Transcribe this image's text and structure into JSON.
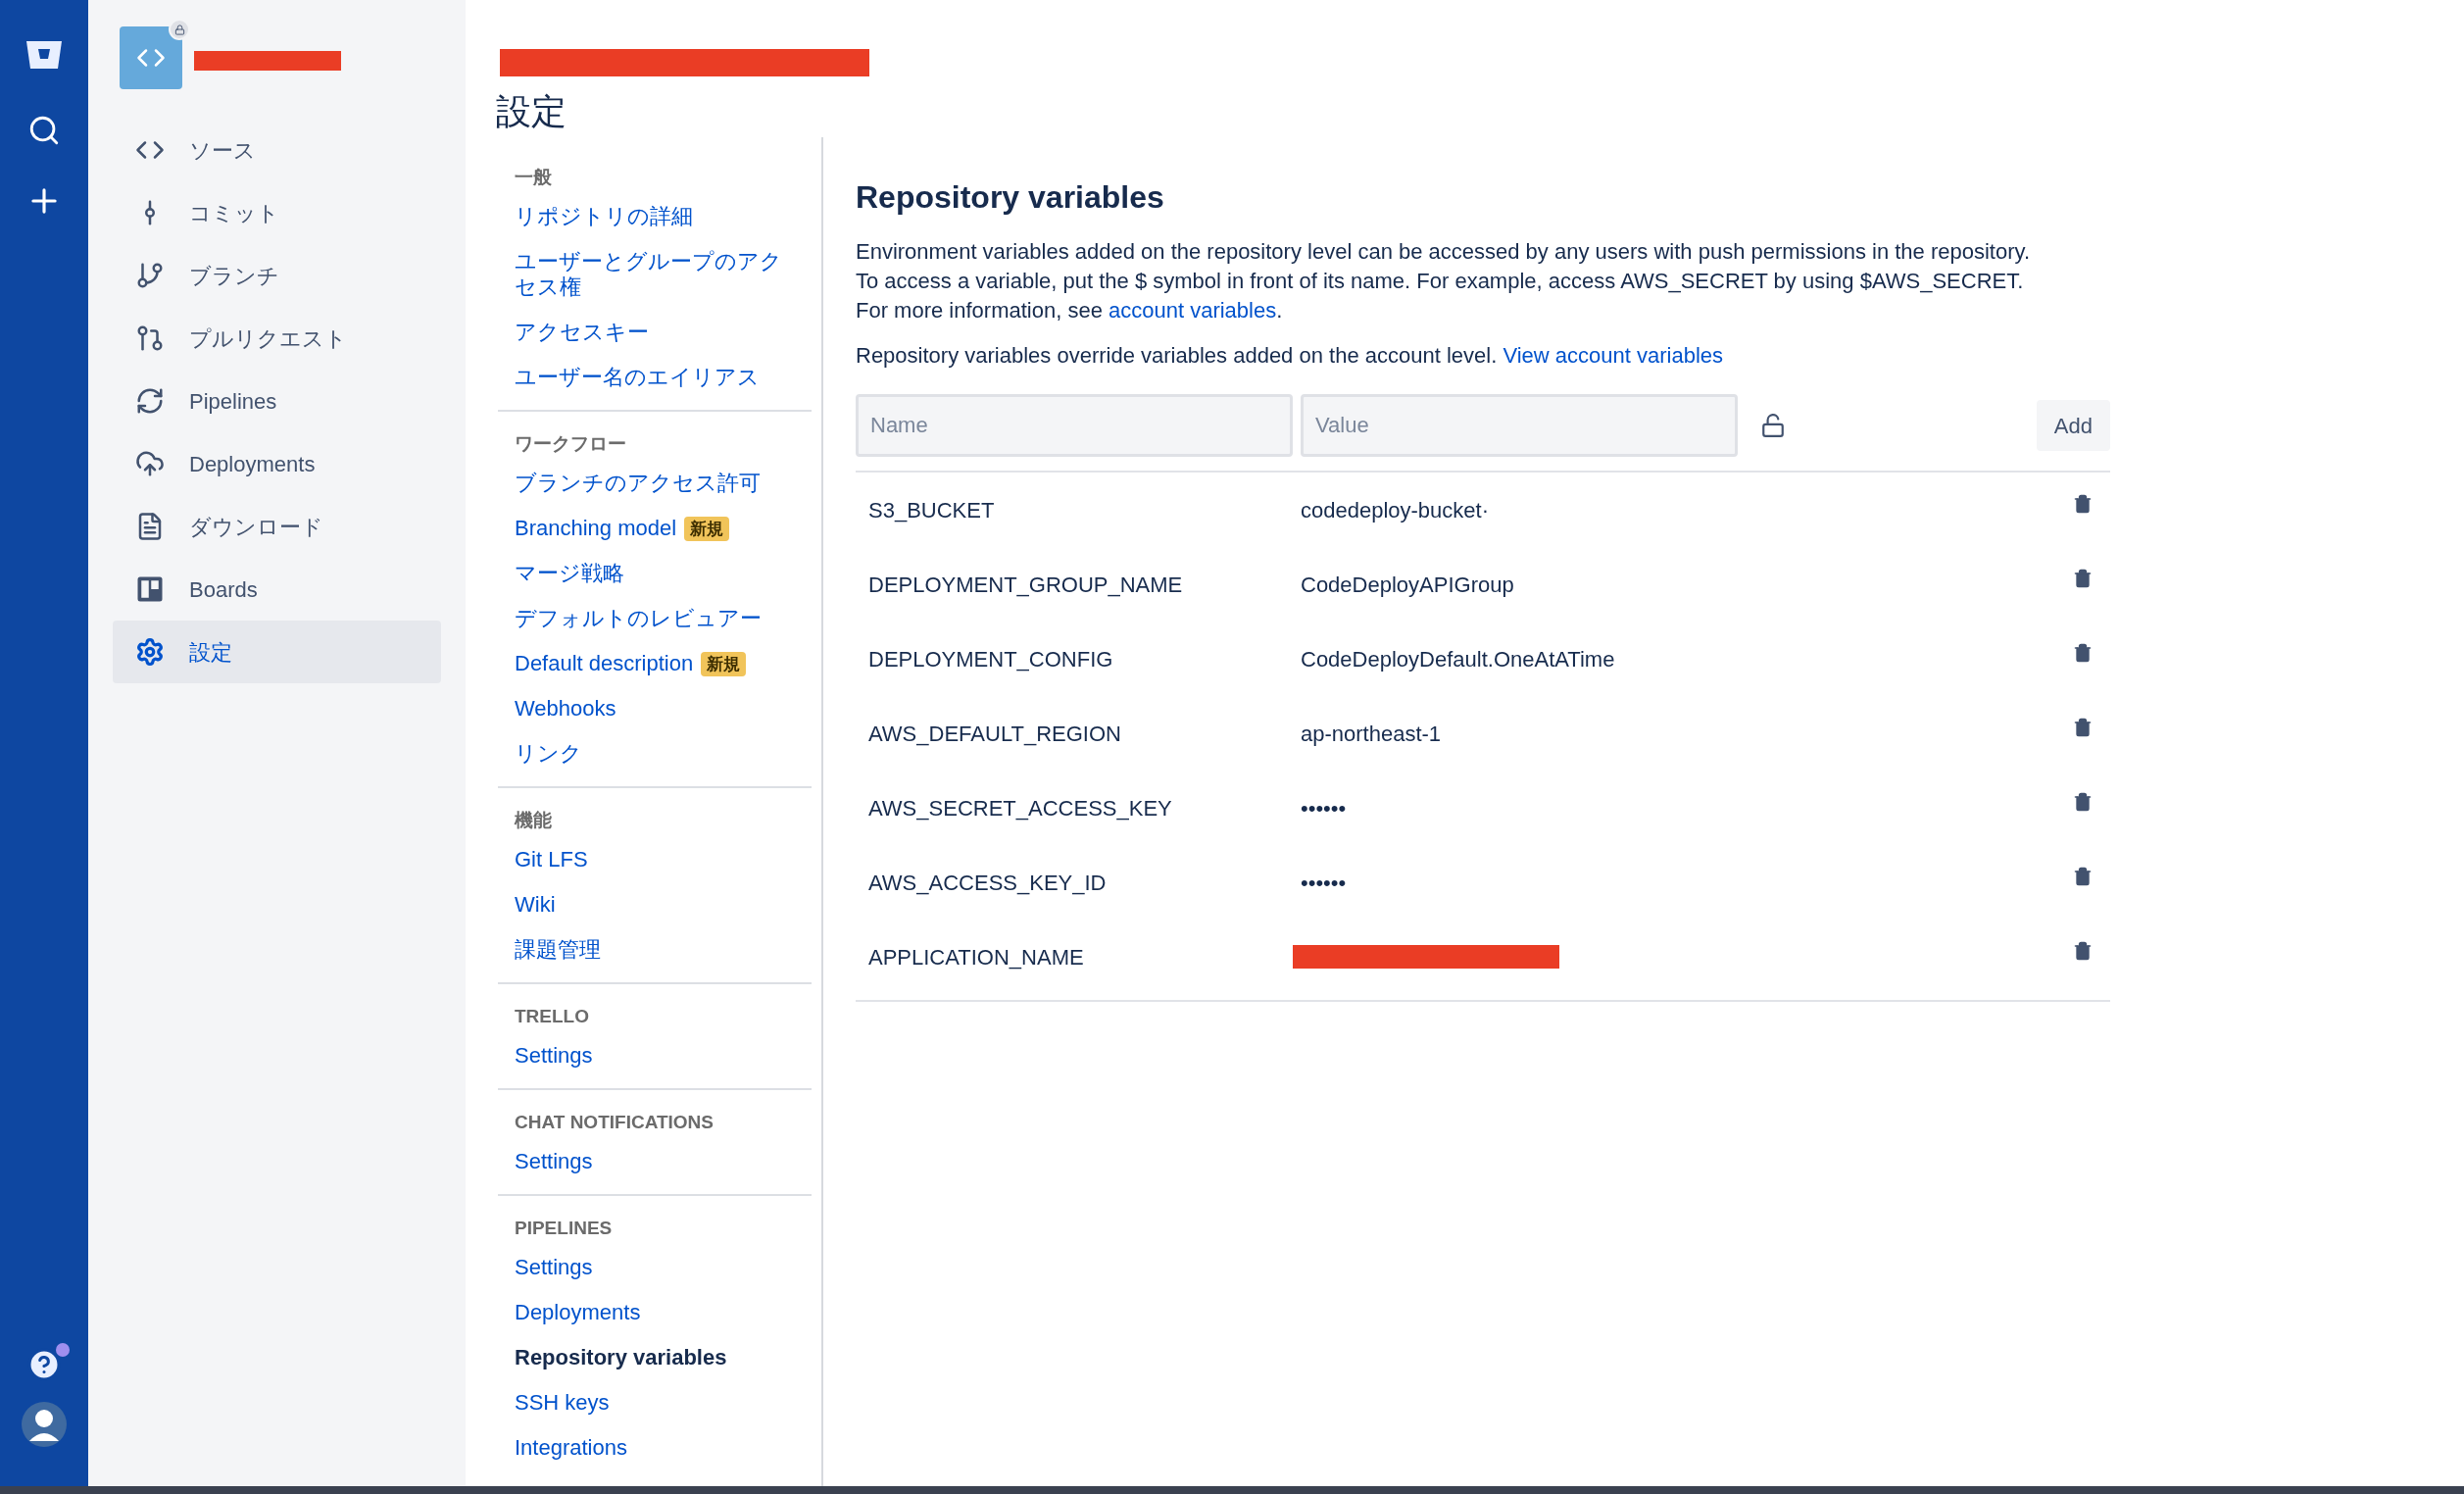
{
  "sidebar": {
    "items": [
      {
        "label": "ソース",
        "selected": false
      },
      {
        "label": "コミット",
        "selected": false
      },
      {
        "label": "ブランチ",
        "selected": false
      },
      {
        "label": "プルリクエスト",
        "selected": false
      },
      {
        "label": "Pipelines",
        "selected": false
      },
      {
        "label": "Deployments",
        "selected": false
      },
      {
        "label": "ダウンロード",
        "selected": false
      },
      {
        "label": "Boards",
        "selected": false
      },
      {
        "label": "設定",
        "selected": true
      }
    ]
  },
  "page": {
    "title": "設定"
  },
  "settings_nav": {
    "sections": [
      {
        "heading": "一般",
        "items": [
          {
            "label": "リポジトリの詳細",
            "selected": false
          },
          {
            "label": "ユーザーとグループのアクセス権",
            "selected": false
          },
          {
            "label": "アクセスキー",
            "selected": false
          },
          {
            "label": "ユーザー名のエイリアス",
            "selected": false
          }
        ]
      },
      {
        "heading": "ワークフロー",
        "items": [
          {
            "label": "ブランチのアクセス許可",
            "selected": false
          },
          {
            "label": "Branching model",
            "badge": "新規",
            "selected": false
          },
          {
            "label": "マージ戦略",
            "selected": false
          },
          {
            "label": "デフォルトのレビュアー",
            "selected": false
          },
          {
            "label": "Default description",
            "badge": "新規",
            "selected": false
          },
          {
            "label": "Webhooks",
            "selected": false
          },
          {
            "label": "リンク",
            "selected": false
          }
        ]
      },
      {
        "heading": "機能",
        "items": [
          {
            "label": "Git LFS",
            "selected": false
          },
          {
            "label": "Wiki",
            "selected": false
          },
          {
            "label": "課題管理",
            "selected": false
          }
        ]
      },
      {
        "heading": "TRELLO",
        "items": [
          {
            "label": "Settings",
            "selected": false
          }
        ]
      },
      {
        "heading": "CHAT NOTIFICATIONS",
        "items": [
          {
            "label": "Settings",
            "selected": false
          }
        ]
      },
      {
        "heading": "PIPELINES",
        "items": [
          {
            "label": "Settings",
            "selected": false
          },
          {
            "label": "Deployments",
            "selected": false
          },
          {
            "label": "Repository variables",
            "selected": true
          },
          {
            "label": "SSH keys",
            "selected": false
          },
          {
            "label": "Integrations",
            "selected": false
          }
        ]
      }
    ]
  },
  "content": {
    "title": "Repository variables",
    "paragraphs": [
      {
        "text": "Environment variables added on the repository level can be accessed by any users with push permissions in the repository. To access a variable, put the $ symbol in front of its name. For example, access AWS_SECRET by using $AWS_SECRET. For more information, see",
        "link": "account variables",
        "after": "."
      },
      {
        "text": "Repository variables override variables added on the account level.",
        "link": "View account variables"
      }
    ],
    "form": {
      "name_placeholder": "Name",
      "value_placeholder": "Value",
      "secured": false,
      "add_button": "Add"
    },
    "variables": [
      {
        "name": "S3_BUCKET",
        "value": "codedeploy-bucket·",
        "redacted": false
      },
      {
        "name": "DEPLOYMENT_GROUP_NAME",
        "value": "CodeDeployAPIGroup",
        "redacted": false
      },
      {
        "name": "DEPLOYMENT_CONFIG",
        "value": "CodeDeployDefault.OneAtATime",
        "redacted": false
      },
      {
        "name": "AWS_DEFAULT_REGION",
        "value": "ap-northeast-1",
        "redacted": false
      },
      {
        "name": "AWS_SECRET_ACCESS_KEY",
        "value": "••••••",
        "redacted": false
      },
      {
        "name": "AWS_ACCESS_KEY_ID",
        "value": "••••••",
        "redacted": false
      },
      {
        "name": "APPLICATION_NAME",
        "redacted": true
      }
    ]
  }
}
